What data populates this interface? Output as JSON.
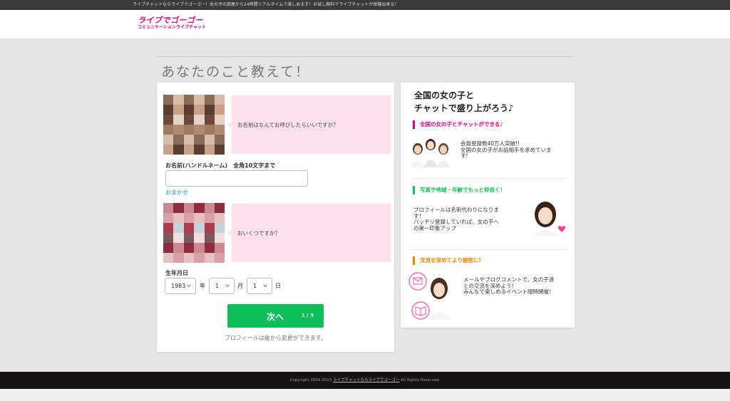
{
  "topbar": {
    "text": "ライブチャットならライブでゴーゴー！女の子の部屋から24時間リアルタイムで楽しめます！お試し無料でライブチャットが体験出来る！"
  },
  "logo": {
    "main": "ライブでゴーゴー",
    "sub": "コミュニケーションライブチャット"
  },
  "page": {
    "title": "あなたのこと教えて！"
  },
  "form": {
    "q1": "お名前はなんてお呼びしたらいいですか？",
    "name_label": "お名前(ハンドルネーム)　全角10文字まで",
    "name_value": "",
    "omakase": "おまかせ",
    "q2": "おいくつですか？",
    "birth_label": "生年月日",
    "year": "1983",
    "year_unit": "年",
    "month": "1",
    "month_unit": "月",
    "day": "1",
    "day_unit": "日",
    "next_label": "次へ",
    "next_count": "1 / 3",
    "note": "プロフィールは後から変更ができます。"
  },
  "side": {
    "title_line1": "全国の女の子と",
    "title_line2": "チャットで盛り上がろう♪",
    "sections": [
      {
        "heading": "全国の女の子とチャットができる♪",
        "line1": "会員登録数40万人突破!!",
        "line2": "全国の女の子がお話相手を求めていま",
        "line3": "す!",
        "color": "#e4007f"
      },
      {
        "heading": "写真や地域・年齢でもっと仲良く！",
        "line1": "プロフィールは名刺代わりになりま",
        "line2": "す！",
        "line3": "バッチリ登録していれば、女の子へ",
        "line4": "の第一印象アップ",
        "color": "#0ec05a"
      },
      {
        "heading": "交流を深めてより親密に!",
        "line1": "メールやブログコメントで、女の子達",
        "line2": "との交流を深めよう！",
        "line3": "みんなで楽しめるイベント随時開催！",
        "color": "#f08300"
      }
    ]
  },
  "footer": {
    "prefix": "Copyright 2004-2023",
    "link": "ライブチャットならライブでゴーゴー",
    "suffix": "All Rights Reserved."
  }
}
